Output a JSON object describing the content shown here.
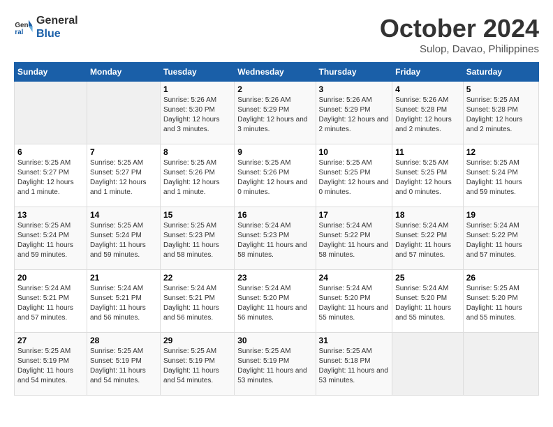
{
  "header": {
    "logo_line1": "General",
    "logo_line2": "Blue",
    "month": "October 2024",
    "location": "Sulop, Davao, Philippines"
  },
  "weekdays": [
    "Sunday",
    "Monday",
    "Tuesday",
    "Wednesday",
    "Thursday",
    "Friday",
    "Saturday"
  ],
  "weeks": [
    [
      {
        "day": "",
        "sunrise": "",
        "sunset": "",
        "daylight": "",
        "empty": true
      },
      {
        "day": "",
        "sunrise": "",
        "sunset": "",
        "daylight": "",
        "empty": true
      },
      {
        "day": "1",
        "sunrise": "Sunrise: 5:26 AM",
        "sunset": "Sunset: 5:30 PM",
        "daylight": "Daylight: 12 hours and 3 minutes."
      },
      {
        "day": "2",
        "sunrise": "Sunrise: 5:26 AM",
        "sunset": "Sunset: 5:29 PM",
        "daylight": "Daylight: 12 hours and 3 minutes."
      },
      {
        "day": "3",
        "sunrise": "Sunrise: 5:26 AM",
        "sunset": "Sunset: 5:29 PM",
        "daylight": "Daylight: 12 hours and 2 minutes."
      },
      {
        "day": "4",
        "sunrise": "Sunrise: 5:26 AM",
        "sunset": "Sunset: 5:28 PM",
        "daylight": "Daylight: 12 hours and 2 minutes."
      },
      {
        "day": "5",
        "sunrise": "Sunrise: 5:25 AM",
        "sunset": "Sunset: 5:28 PM",
        "daylight": "Daylight: 12 hours and 2 minutes."
      }
    ],
    [
      {
        "day": "6",
        "sunrise": "Sunrise: 5:25 AM",
        "sunset": "Sunset: 5:27 PM",
        "daylight": "Daylight: 12 hours and 1 minute."
      },
      {
        "day": "7",
        "sunrise": "Sunrise: 5:25 AM",
        "sunset": "Sunset: 5:27 PM",
        "daylight": "Daylight: 12 hours and 1 minute."
      },
      {
        "day": "8",
        "sunrise": "Sunrise: 5:25 AM",
        "sunset": "Sunset: 5:26 PM",
        "daylight": "Daylight: 12 hours and 1 minute."
      },
      {
        "day": "9",
        "sunrise": "Sunrise: 5:25 AM",
        "sunset": "Sunset: 5:26 PM",
        "daylight": "Daylight: 12 hours and 0 minutes."
      },
      {
        "day": "10",
        "sunrise": "Sunrise: 5:25 AM",
        "sunset": "Sunset: 5:25 PM",
        "daylight": "Daylight: 12 hours and 0 minutes."
      },
      {
        "day": "11",
        "sunrise": "Sunrise: 5:25 AM",
        "sunset": "Sunset: 5:25 PM",
        "daylight": "Daylight: 12 hours and 0 minutes."
      },
      {
        "day": "12",
        "sunrise": "Sunrise: 5:25 AM",
        "sunset": "Sunset: 5:24 PM",
        "daylight": "Daylight: 11 hours and 59 minutes."
      }
    ],
    [
      {
        "day": "13",
        "sunrise": "Sunrise: 5:25 AM",
        "sunset": "Sunset: 5:24 PM",
        "daylight": "Daylight: 11 hours and 59 minutes."
      },
      {
        "day": "14",
        "sunrise": "Sunrise: 5:25 AM",
        "sunset": "Sunset: 5:24 PM",
        "daylight": "Daylight: 11 hours and 59 minutes."
      },
      {
        "day": "15",
        "sunrise": "Sunrise: 5:25 AM",
        "sunset": "Sunset: 5:23 PM",
        "daylight": "Daylight: 11 hours and 58 minutes."
      },
      {
        "day": "16",
        "sunrise": "Sunrise: 5:24 AM",
        "sunset": "Sunset: 5:23 PM",
        "daylight": "Daylight: 11 hours and 58 minutes."
      },
      {
        "day": "17",
        "sunrise": "Sunrise: 5:24 AM",
        "sunset": "Sunset: 5:22 PM",
        "daylight": "Daylight: 11 hours and 58 minutes."
      },
      {
        "day": "18",
        "sunrise": "Sunrise: 5:24 AM",
        "sunset": "Sunset: 5:22 PM",
        "daylight": "Daylight: 11 hours and 57 minutes."
      },
      {
        "day": "19",
        "sunrise": "Sunrise: 5:24 AM",
        "sunset": "Sunset: 5:22 PM",
        "daylight": "Daylight: 11 hours and 57 minutes."
      }
    ],
    [
      {
        "day": "20",
        "sunrise": "Sunrise: 5:24 AM",
        "sunset": "Sunset: 5:21 PM",
        "daylight": "Daylight: 11 hours and 57 minutes."
      },
      {
        "day": "21",
        "sunrise": "Sunrise: 5:24 AM",
        "sunset": "Sunset: 5:21 PM",
        "daylight": "Daylight: 11 hours and 56 minutes."
      },
      {
        "day": "22",
        "sunrise": "Sunrise: 5:24 AM",
        "sunset": "Sunset: 5:21 PM",
        "daylight": "Daylight: 11 hours and 56 minutes."
      },
      {
        "day": "23",
        "sunrise": "Sunrise: 5:24 AM",
        "sunset": "Sunset: 5:20 PM",
        "daylight": "Daylight: 11 hours and 56 minutes."
      },
      {
        "day": "24",
        "sunrise": "Sunrise: 5:24 AM",
        "sunset": "Sunset: 5:20 PM",
        "daylight": "Daylight: 11 hours and 55 minutes."
      },
      {
        "day": "25",
        "sunrise": "Sunrise: 5:24 AM",
        "sunset": "Sunset: 5:20 PM",
        "daylight": "Daylight: 11 hours and 55 minutes."
      },
      {
        "day": "26",
        "sunrise": "Sunrise: 5:25 AM",
        "sunset": "Sunset: 5:20 PM",
        "daylight": "Daylight: 11 hours and 55 minutes."
      }
    ],
    [
      {
        "day": "27",
        "sunrise": "Sunrise: 5:25 AM",
        "sunset": "Sunset: 5:19 PM",
        "daylight": "Daylight: 11 hours and 54 minutes."
      },
      {
        "day": "28",
        "sunrise": "Sunrise: 5:25 AM",
        "sunset": "Sunset: 5:19 PM",
        "daylight": "Daylight: 11 hours and 54 minutes."
      },
      {
        "day": "29",
        "sunrise": "Sunrise: 5:25 AM",
        "sunset": "Sunset: 5:19 PM",
        "daylight": "Daylight: 11 hours and 54 minutes."
      },
      {
        "day": "30",
        "sunrise": "Sunrise: 5:25 AM",
        "sunset": "Sunset: 5:19 PM",
        "daylight": "Daylight: 11 hours and 53 minutes."
      },
      {
        "day": "31",
        "sunrise": "Sunrise: 5:25 AM",
        "sunset": "Sunset: 5:18 PM",
        "daylight": "Daylight: 11 hours and 53 minutes."
      },
      {
        "day": "",
        "sunrise": "",
        "sunset": "",
        "daylight": "",
        "empty": true
      },
      {
        "day": "",
        "sunrise": "",
        "sunset": "",
        "daylight": "",
        "empty": true
      }
    ]
  ]
}
